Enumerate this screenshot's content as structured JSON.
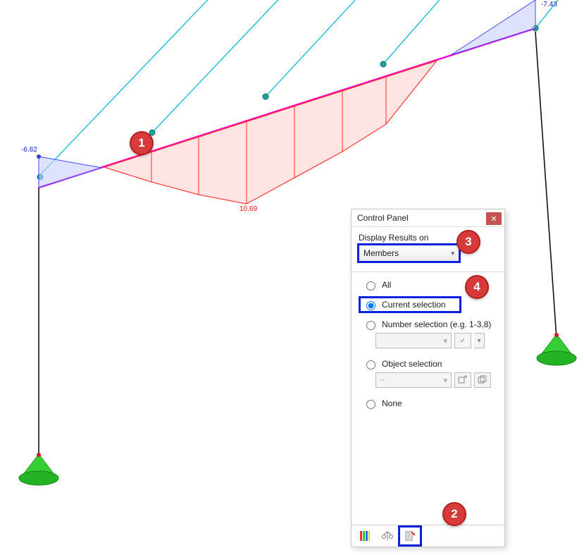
{
  "panel": {
    "title": "Control Panel",
    "display_label": "Display Results on",
    "select_value": "Members",
    "options": {
      "all": "All",
      "current": "Current selection",
      "number": "Number selection (e.g. 1-3,8)",
      "object": "Object selection",
      "none": "None",
      "placeholder_dash": "--"
    },
    "selected_option": "current"
  },
  "diagram": {
    "left_value": "-6.82",
    "right_value": "-7.43",
    "bottom_value": "10.69"
  },
  "annotations": {
    "a1": "1",
    "a2": "2",
    "a3": "3",
    "a4": "4"
  }
}
